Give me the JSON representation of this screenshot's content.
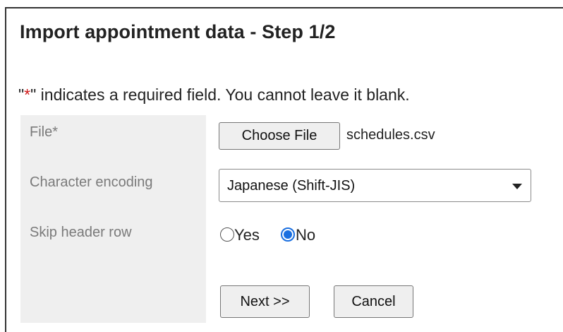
{
  "dialog": {
    "title": "Import appointment data - Step 1/2",
    "required_note": {
      "prefix": "\"",
      "star": "*",
      "suffix": "\" indicates a required field. You cannot leave it blank."
    }
  },
  "form": {
    "file": {
      "label": "File*",
      "button_label": "Choose File",
      "filename": "schedules.csv"
    },
    "encoding": {
      "label": "Character encoding",
      "selected": "Japanese (Shift-JIS)"
    },
    "skip_header": {
      "label": "Skip header row",
      "options": [
        {
          "label": "Yes",
          "checked": false
        },
        {
          "label": "No",
          "checked": true
        }
      ]
    }
  },
  "actions": {
    "next_label": "Next >>",
    "cancel_label": "Cancel"
  },
  "colors": {
    "required_star": "#d01818",
    "radio_accent": "#1a6fe0",
    "label_column_bg": "#efefef"
  }
}
